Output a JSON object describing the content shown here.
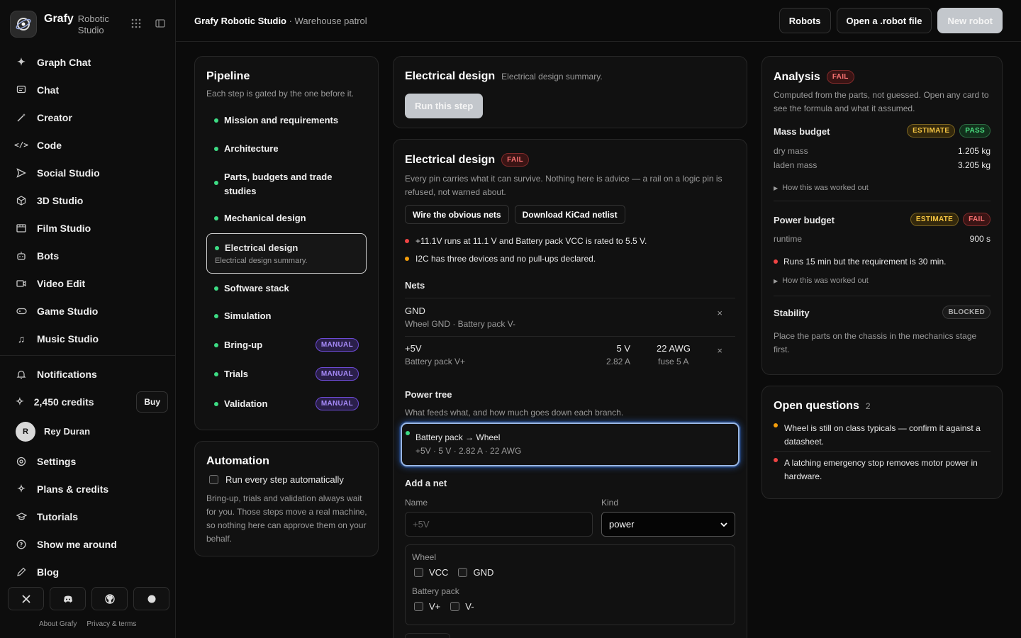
{
  "brand": {
    "name": "Grafy",
    "sub": "Robotic Studio"
  },
  "nav": [
    {
      "label": "Graph Chat",
      "icon": "sparkle-icon"
    },
    {
      "label": "Chat",
      "icon": "chat-icon"
    },
    {
      "label": "Creator",
      "icon": "wand-icon"
    },
    {
      "label": "Code",
      "icon": "code-icon"
    },
    {
      "label": "Social Studio",
      "icon": "send-icon"
    },
    {
      "label": "3D Studio",
      "icon": "cube-icon"
    },
    {
      "label": "Film Studio",
      "icon": "film-icon"
    },
    {
      "label": "Bots",
      "icon": "bot-icon"
    },
    {
      "label": "Video Edit",
      "icon": "video-icon"
    },
    {
      "label": "Game Studio",
      "icon": "gamepad-icon"
    },
    {
      "label": "Music Studio",
      "icon": "music-icon"
    }
  ],
  "account": {
    "notifications": "Notifications",
    "credits": "2,450 credits",
    "buy": "Buy",
    "user_initial": "R",
    "user_name": "Rey Duran",
    "settings": "Settings",
    "plans": "Plans & credits",
    "tutorials": "Tutorials",
    "tour": "Show me around",
    "blog": "Blog"
  },
  "footer": {
    "about": "About Grafy",
    "privacy": "Privacy & terms"
  },
  "topbar": {
    "app": "Grafy Robotic Studio",
    "project": " · Warehouse patrol",
    "robots": "Robots",
    "open_file": "Open a .robot file",
    "new_robot": "New robot"
  },
  "pipeline": {
    "title": "Pipeline",
    "subtitle": "Each step is gated by the one before it.",
    "steps": [
      {
        "label": "Mission and requirements"
      },
      {
        "label": "Architecture"
      },
      {
        "label": "Parts, budgets and trade studies"
      },
      {
        "label": "Mechanical design"
      },
      {
        "label": "Electrical design",
        "desc": "Electrical design summary."
      },
      {
        "label": "Software stack"
      },
      {
        "label": "Simulation"
      },
      {
        "label": "Bring-up",
        "badge": "MANUAL"
      },
      {
        "label": "Trials",
        "badge": "MANUAL"
      },
      {
        "label": "Validation",
        "badge": "MANUAL"
      }
    ]
  },
  "automation": {
    "title": "Automation",
    "checkbox": "Run every step automatically",
    "note": "Bring-up, trials and validation always wait for you. Those steps move a real machine, so nothing here can approve them on your behalf."
  },
  "step_card": {
    "title": "Electrical design",
    "subtitle": "Electrical design summary.",
    "run": "Run this step"
  },
  "electrical": {
    "title": "Electrical design",
    "status": "FAIL",
    "desc": "Every pin carries what it can survive. Nothing here is advice — a rail on a logic pin is refused, not warned about.",
    "btn_wire": "Wire the obvious nets",
    "btn_kicad": "Download KiCad netlist",
    "issues": [
      {
        "text": "+11.1V runs at 11.1 V and Battery pack VCC is rated to 5.5 V.",
        "level": "error"
      },
      {
        "text": "I2C has three devices and no pull-ups declared.",
        "level": "warning"
      }
    ],
    "nets_title": "Nets",
    "nets": [
      {
        "name": "GND",
        "members": "Wheel GND · Battery pack V-"
      },
      {
        "name": "+5V",
        "members": "Battery pack V+",
        "voltage": "5 V",
        "current": "2.82 A",
        "gauge": "22 AWG",
        "fuse": "fuse 5 A"
      }
    ],
    "remove_glyph": "×",
    "power_tree_title": "Power tree",
    "power_tree_desc": "What feeds what, and how much goes down each branch.",
    "branch_title": "Battery pack → Wheel",
    "branch_detail": "+5V · 5 V · 2.82 A · 22 AWG",
    "add_net_title": "Add a net",
    "name_label": "Name",
    "name_placeholder": "+5V",
    "kind_label": "Kind",
    "kind_value": "power",
    "parts": [
      {
        "name": "Wheel",
        "pins": [
          "VCC",
          "GND"
        ]
      },
      {
        "name": "Battery pack",
        "pins": [
          "V+",
          "V-"
        ]
      }
    ]
  },
  "analysis": {
    "title": "Analysis",
    "status": "FAIL",
    "desc": "Computed from the parts, not guessed. Open any card to see the formula and what it assumed.",
    "mass": {
      "title": "Mass budget",
      "badge1": "ESTIMATE",
      "badge2": "PASS",
      "rows": [
        {
          "k": "dry mass",
          "v": "1.205 kg"
        },
        {
          "k": "laden mass",
          "v": "3.205 kg"
        }
      ],
      "toggle": "How this was worked out"
    },
    "power": {
      "title": "Power budget",
      "badge1": "ESTIMATE",
      "badge2": "FAIL",
      "rows": [
        {
          "k": "runtime",
          "v": "900 s"
        }
      ],
      "issue": "Runs 15 min but the requirement is 30 min.",
      "toggle": "How this was worked out"
    },
    "stability": {
      "title": "Stability",
      "badge": "BLOCKED",
      "desc": "Place the parts on the chassis in the mechanics stage first."
    }
  },
  "questions": {
    "title": "Open questions",
    "count": "2",
    "items": [
      {
        "text": "Wheel is still on class typicals — confirm it against a datasheet.",
        "level": "warning"
      },
      {
        "text": "A latching emergency stop removes motor power in hardware.",
        "level": "error"
      }
    ]
  },
  "colors": {
    "accent": "#3ddc84",
    "error": "#ef4444",
    "warning": "#f59e0b",
    "manual": "#a78bfa",
    "highlight": "#3b82f6"
  }
}
